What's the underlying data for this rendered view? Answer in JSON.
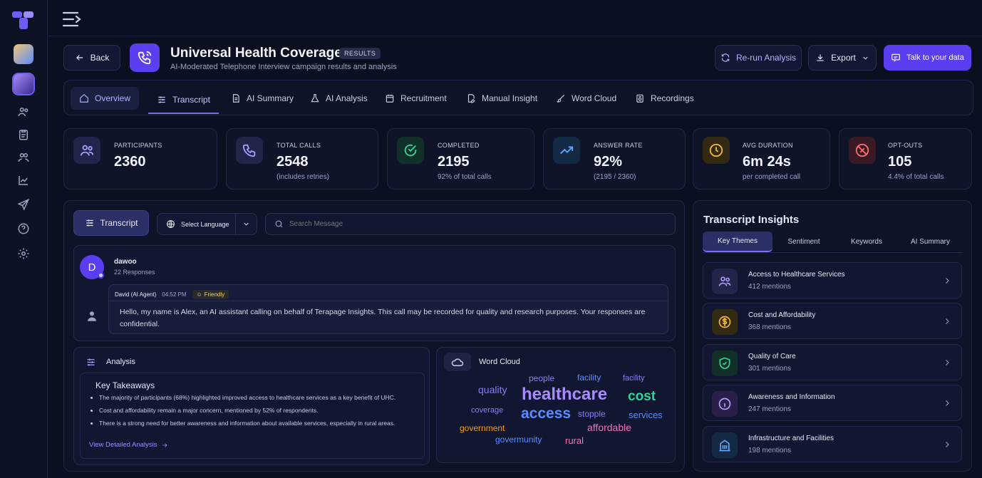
{
  "header": {
    "back_label": "Back",
    "title": "Universal Health Coverage",
    "badge": "RESULTS",
    "subtitle": "AI-Moderated Telephone Interview campaign results and analysis",
    "rerun_label": "Re-run Analysis",
    "export_label": "Export",
    "talk_label": "Talk to your data"
  },
  "tabs": [
    {
      "label": "Overview"
    },
    {
      "label": "Transcript"
    },
    {
      "label": "AI Summary"
    },
    {
      "label": "AI Analysis"
    },
    {
      "label": "Recruitment"
    },
    {
      "label": "Manual Insight"
    },
    {
      "label": "Word Cloud"
    },
    {
      "label": "Recordings"
    }
  ],
  "stats": [
    {
      "label": "PARTICIPANTS",
      "value": "2360",
      "note": ""
    },
    {
      "label": "TOTAL CALLS",
      "value": "2548",
      "note": "(includes retries)"
    },
    {
      "label": "COMPLETED",
      "value": "2195",
      "note": "92% of total calls"
    },
    {
      "label": "ANSWER RATE",
      "value": "92%",
      "note": "(2195 / 2360)"
    },
    {
      "label": "AVG DURATION",
      "value": "6m 24s",
      "note": "per completed call"
    },
    {
      "label": "OPT-OUTS",
      "value": "105",
      "note": "4.4% of total calls"
    }
  ],
  "transcript": {
    "button_label": "Transcript",
    "language_label": "Select Language",
    "search_placeholder": "Search Message",
    "user_initial": "D",
    "user_name": "dawoo",
    "user_responses": "22 Responses",
    "agent_name": "David (AI Agent)",
    "time": "04:52 PM",
    "tone": "Friendly",
    "message": "Hello, my name is Alex, an AI assistant calling on behalf of Terapage Insights. This call may be recorded for quality and research purposes. Your responses are confidential."
  },
  "analysis": {
    "title": "Analysis",
    "heading": "Key Takeaways",
    "items": [
      "The majority of participants (68%) highlighted improved access to healthcare services as a key benefit of UHC.",
      "Cost and affordability remain a major concern, mentioned by 52% of respondents.",
      "There is a strong need for better awareness and information about available services, especially in rural areas."
    ],
    "link_label": "View Detailed Analysis"
  },
  "wordcloud": {
    "title": "Word Cloud",
    "words": [
      "people",
      "facility",
      "facility",
      "quality",
      "healthcare",
      "cost",
      "coverage",
      "access",
      "stopple",
      "services",
      "government",
      "affordable",
      "govermunity",
      "rural"
    ],
    "colors": {
      "purple": "#8b7cf6",
      "blue": "#5b8cff",
      "green": "#34d399",
      "orange": "#f59e0b",
      "pink": "#f472b6",
      "violet": "#a78bfa"
    }
  },
  "insights": {
    "title": "Transcript Insights",
    "tabs": [
      "Key Themes",
      "Sentiment",
      "Keywords",
      "AI Summary"
    ],
    "themes": [
      {
        "title": "Access to Healthcare Services",
        "mentions": "412 mentions",
        "icon": "people-icon"
      },
      {
        "title": "Cost and Affordability",
        "mentions": "368 mentions",
        "icon": "dollar-icon"
      },
      {
        "title": "Quality of Care",
        "mentions": "301 mentions",
        "icon": "shield-check-icon"
      },
      {
        "title": "Awareness and Information",
        "mentions": "247 mentions",
        "icon": "info-icon"
      },
      {
        "title": "Infrastructure and Facilities",
        "mentions": "198 mentions",
        "icon": "building-icon"
      }
    ]
  },
  "colors": {
    "accent": "#5b3ef0",
    "bg": "#0b1020",
    "panel": "#0e1328"
  }
}
